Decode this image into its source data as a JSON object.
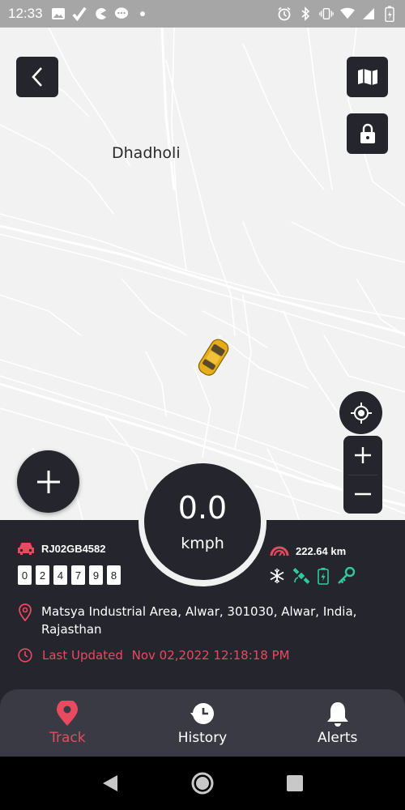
{
  "status_bar": {
    "time": "12:33",
    "left_icons": [
      "image-icon",
      "check-icon",
      "pacman-icon",
      "chat-bubble-icon",
      "dot-icon"
    ],
    "right_icons": [
      "alarm-icon",
      "bluetooth-icon",
      "vibrate-icon",
      "wifi-icon",
      "signal-icon",
      "battery-icon"
    ]
  },
  "map": {
    "place_label": "Dhadholi"
  },
  "vehicle": {
    "plate": "RJ02GB4582",
    "odometer": [
      "0",
      "2",
      "4",
      "7",
      "9",
      "8"
    ],
    "distance": "222.64 km",
    "speed": "0.0",
    "speed_unit": "kmph"
  },
  "location": {
    "address": "Matsya Industrial Area, Alwar, 301030, Alwar, India, Rajasthan",
    "updated_label": "Last Updated",
    "updated_value": "Nov 02,2022 12:18:18 PM"
  },
  "nav": {
    "items": [
      {
        "label": "Track"
      },
      {
        "label": "History"
      },
      {
        "label": "Alerts"
      }
    ]
  },
  "colors": {
    "dark_panel": "#25252d",
    "accent": "#e84a5f",
    "green": "#2ecc9a"
  }
}
